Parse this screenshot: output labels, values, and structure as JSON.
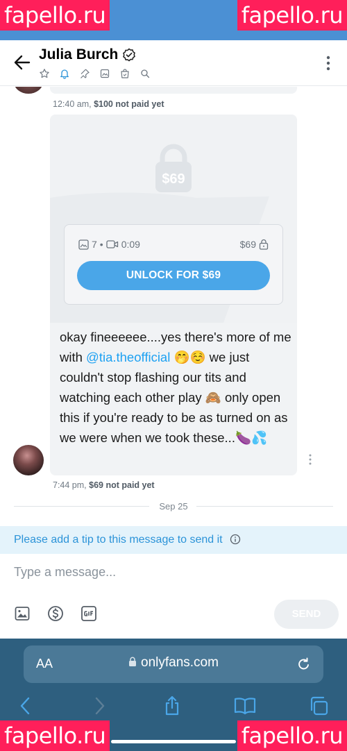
{
  "watermark": "fapello.ru",
  "header": {
    "title": "Julia Burch"
  },
  "chat": {
    "prev_meta_time": "12:40 am,",
    "prev_meta_status": "$100 not paid yet",
    "locked_price": "$69",
    "media_photos": "7",
    "media_separator": "•",
    "media_video_duration": "0:09",
    "media_price": "$69",
    "unlock_label": "UNLOCK FOR $69",
    "message_part1": "okay fineeeeee....yes there's more of me with ",
    "mention": "@tia.theofficial",
    "message_part2": " 🤭☺️ we just couldn't stop flashing our tits and watching each other play 🙈 only open this if you're ready to be as turned on as we were when we took these...🍆💦",
    "meta_time": "7:44 pm,",
    "meta_status": "$69 not paid yet",
    "date_separator": "Sep 25"
  },
  "tip_banner": "Please add a tip to this message to send it",
  "composer": {
    "placeholder": "Type a message...",
    "send_label": "SEND"
  },
  "browser": {
    "aa_label": "AA",
    "url": "onlyfans.com"
  },
  "colors": {
    "accent": "#4aa6e8",
    "mention": "#1da1f2",
    "tip_text": "#2b93d8",
    "safari_bar": "#2e5f7f"
  }
}
